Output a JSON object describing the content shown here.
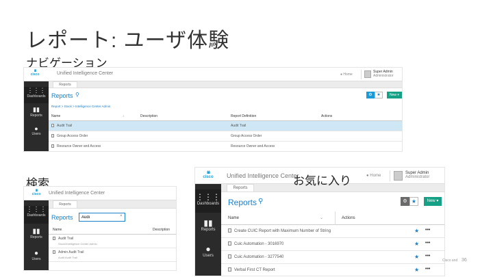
{
  "slide": {
    "title": "レポート: ユーザ体験",
    "sub_nav": "ナビゲーション",
    "sub_search": "検索",
    "sub_fav": "お気に入り",
    "footer_left": "Cisco and",
    "page_number": "36"
  },
  "nav_shot": {
    "app_title": "Unified Intelligence Center",
    "home": "Home",
    "user_name": "Super Admin",
    "user_role": "Administrator",
    "tab": "Reports",
    "page_title": "Reports",
    "breadcrumb": "Report > Stock > Intelligence Center Admin",
    "sidebar": [
      {
        "icon": "dashboard-icon",
        "label": "Dashboards"
      },
      {
        "icon": "reports-icon",
        "label": "Reports"
      },
      {
        "icon": "users-icon",
        "label": "Users"
      }
    ],
    "columns": [
      "Name",
      "Description",
      "Report Definition",
      "Actions"
    ],
    "rows": [
      {
        "name": "Audit Trail",
        "definition": "Audit Trail",
        "selected": true
      },
      {
        "name": "Group Access Order",
        "definition": "Group Access Order",
        "selected": false
      },
      {
        "name": "Resource Owner and Access",
        "definition": "Resource Owner and Access",
        "selected": false
      }
    ],
    "new_button": "New"
  },
  "search_shot": {
    "app_title": "Unified Intelligence Center",
    "tab": "Reports",
    "page_title": "Reports",
    "search_value": "Audi",
    "sidebar": [
      {
        "icon": "dashboard-icon",
        "label": "Dashboards"
      },
      {
        "icon": "reports-icon",
        "label": "Reports"
      },
      {
        "icon": "users-icon",
        "label": "Users"
      }
    ],
    "columns": [
      "Name",
      "Description"
    ],
    "rows": [
      {
        "name": "Audit Trail",
        "sub": "Stock/Intelligence Center Admin"
      },
      {
        "name": "Admin Audit Trail",
        "sub": "Audit Audit Trail"
      }
    ]
  },
  "fav_shot": {
    "app_title": "Unified Intelligence Center",
    "home": "Home",
    "user_name": "Super Admin",
    "user_role": "Administrator",
    "tab": "Reports",
    "page_title": "Reports",
    "sidebar": [
      {
        "icon": "dashboard-icon",
        "label": "Dashboards"
      },
      {
        "icon": "reports-icon",
        "label": "Reports"
      },
      {
        "icon": "users-icon",
        "label": "Users"
      }
    ],
    "columns": [
      "Name",
      "Actions"
    ],
    "rows": [
      {
        "name": "Create CUIC Report with Maximum Number of String"
      },
      {
        "name": "Cuic Automation - 3016970"
      },
      {
        "name": "Cuic Automation - 3277540"
      },
      {
        "name": "Verbal First CT Report"
      }
    ],
    "new_button": "New"
  }
}
